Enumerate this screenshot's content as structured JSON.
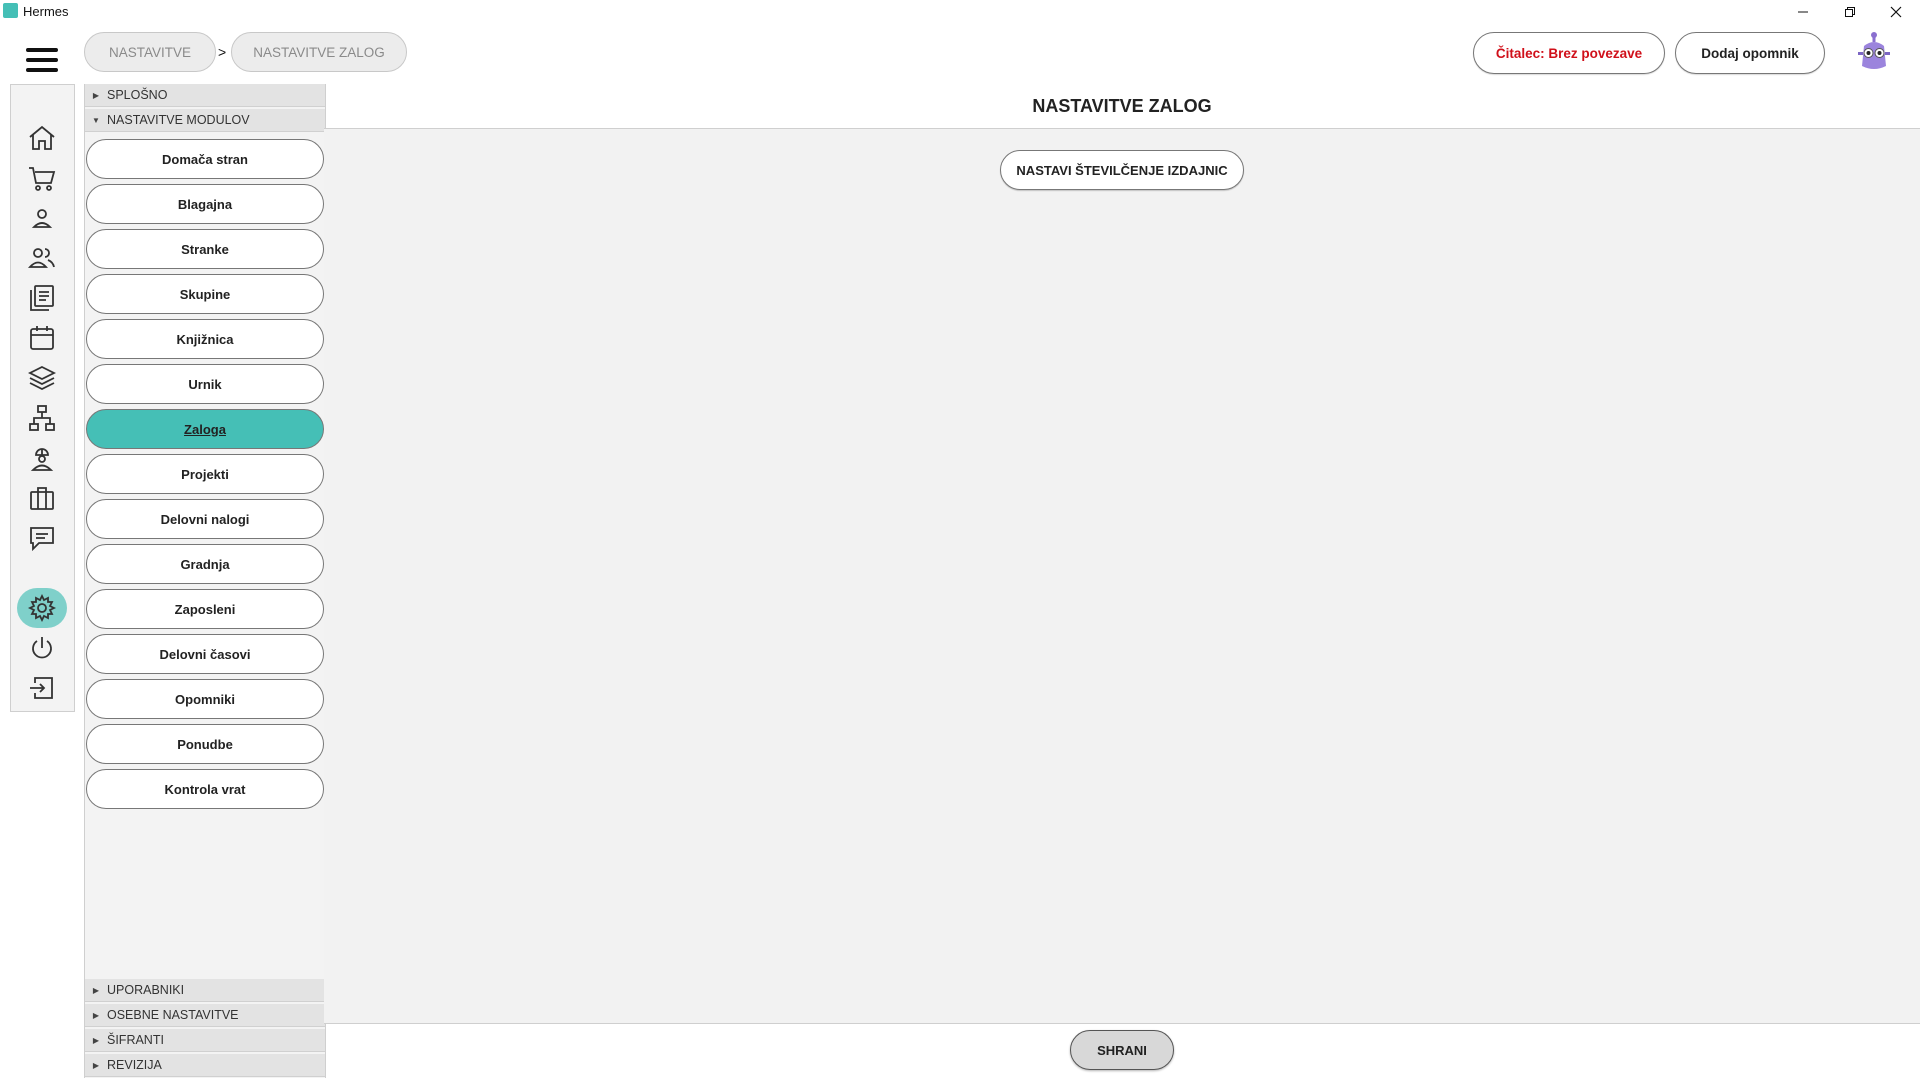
{
  "window": {
    "title": "Hermes"
  },
  "breadcrumb": {
    "items": [
      "NASTAVITVE",
      "NASTAVITVE ZALOG"
    ],
    "separator": ">"
  },
  "header": {
    "reader_status": "Čitalec: Brez povezave",
    "add_reminder": "Dodaj opomnik"
  },
  "rail": {
    "icons": [
      "home-icon",
      "cart-icon",
      "person-icon",
      "group-icon",
      "documents-icon",
      "calendar-icon",
      "layers-icon",
      "network-icon",
      "worker-icon",
      "briefcase-icon",
      "chat-icon",
      "gear-icon",
      "power-icon",
      "logout-icon"
    ],
    "active": "gear-icon",
    "accent": "#7fd0ca"
  },
  "nav": {
    "sections_top": [
      "SPLOŠNO",
      "NASTAVITVE MODULOV"
    ],
    "modules": [
      "Domača stran",
      "Blagajna",
      "Stranke",
      "Skupine",
      "Knjižnica",
      "Urnik",
      "Zaloga",
      "Projekti",
      "Delovni nalogi",
      "Gradnja",
      "Zaposleni",
      "Delovni časovi",
      "Opomniki",
      "Ponudbe",
      "Kontrola vrat"
    ],
    "active_module": "Zaloga",
    "sections_bottom": [
      "UPORABNIKI",
      "OSEBNE NASTAVITVE",
      "ŠIFRANTI",
      "REVIZIJA"
    ]
  },
  "main": {
    "title": "NASTAVITVE ZALOG",
    "numbering_button": "NASTAVI ŠTEVILČENJE IZDAJNIC",
    "save_button": "SHRANI"
  },
  "colors": {
    "accent": "#45bfb6",
    "warning_text": "#d0101a"
  }
}
